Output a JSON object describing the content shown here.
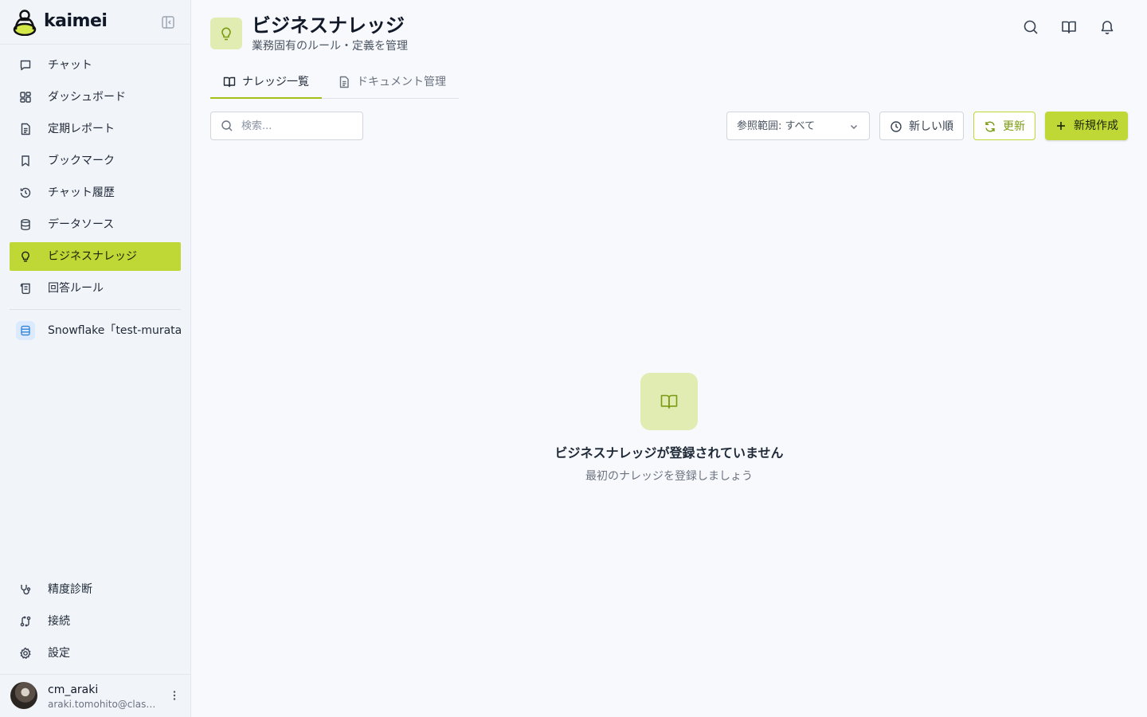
{
  "brand": {
    "name": "kaimei"
  },
  "sidebar": {
    "items": [
      {
        "label": "チャット",
        "icon": "chat-icon"
      },
      {
        "label": "ダッシュボード",
        "icon": "dashboard-icon"
      },
      {
        "label": "定期レポート",
        "icon": "report-icon"
      },
      {
        "label": "ブックマーク",
        "icon": "bookmark-icon"
      },
      {
        "label": "チャット履歴",
        "icon": "history-icon"
      },
      {
        "label": "データソース",
        "icon": "database-icon"
      },
      {
        "label": "ビジネスナレッジ",
        "icon": "lightbulb-icon",
        "active": true
      },
      {
        "label": "回答ルール",
        "icon": "scroll-icon"
      }
    ],
    "datasource": {
      "label": "Snowflake「test-murata」",
      "icon": "snowflake-db-icon"
    },
    "bottom_items": [
      {
        "label": "精度診断",
        "icon": "stethoscope-icon"
      },
      {
        "label": "接続",
        "icon": "connection-icon"
      },
      {
        "label": "設定",
        "icon": "gear-icon"
      }
    ],
    "user": {
      "name": "cm_araki",
      "email": "araki.tomohito@classmethod.jp"
    }
  },
  "header": {
    "title": "ビジネスナレッジ",
    "subtitle": "業務固有のルール・定義を管理"
  },
  "tabs": [
    {
      "label": "ナレッジ一覧",
      "active": true
    },
    {
      "label": "ドキュメント管理",
      "active": false
    }
  ],
  "toolbar": {
    "search_placeholder": "検索...",
    "scope_label": "参照範囲: すべて",
    "sort_label": "新しい順",
    "refresh_label": "更新",
    "new_label": "新規作成"
  },
  "empty_state": {
    "title": "ビジネスナレッジが登録されていません",
    "description": "最初のナレッジを登録しましょう"
  },
  "colors": {
    "accent": "#bfd835",
    "accent_dark": "#7a9a12",
    "accent_soft": "#e0ecb1"
  }
}
